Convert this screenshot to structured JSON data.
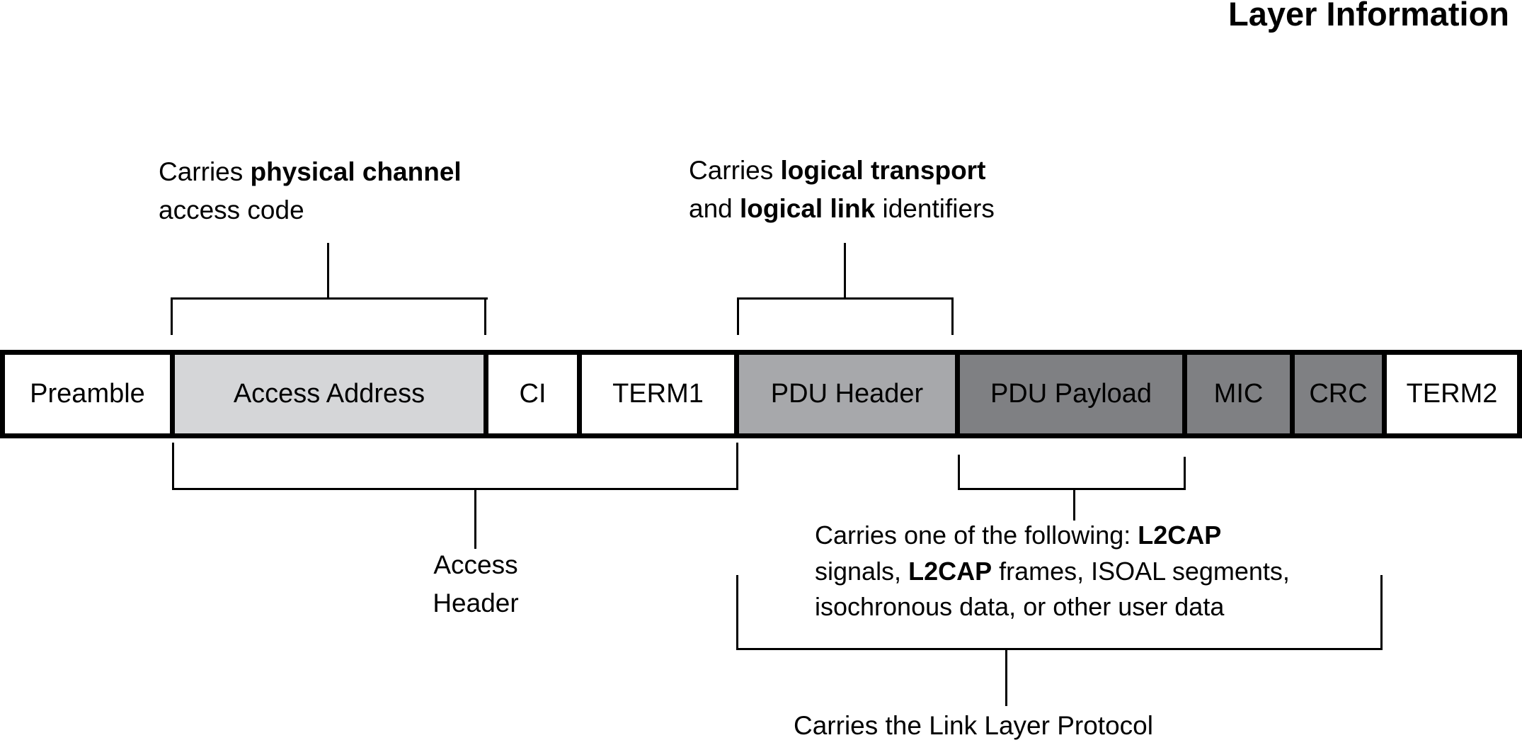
{
  "title": "Layer Information",
  "colors": {
    "white": "#ffffff",
    "light_gray": "#d5d6d8",
    "mid_gray": "#a7a8ab",
    "dark_gray": "#7f8083",
    "line": "#000000"
  },
  "fields": [
    {
      "label": "Preamble",
      "fill": "white"
    },
    {
      "label": "Access Address",
      "fill": "light_gray"
    },
    {
      "label": "CI",
      "fill": "white"
    },
    {
      "label": "TERM1",
      "fill": "white"
    },
    {
      "label": "PDU Header",
      "fill": "mid_gray"
    },
    {
      "label": "PDU Payload",
      "fill": "dark_gray"
    },
    {
      "label": "MIC",
      "fill": "dark_gray"
    },
    {
      "label": "CRC",
      "fill": "dark_gray"
    },
    {
      "label": "TERM2",
      "fill": "white"
    }
  ],
  "annotations": {
    "access_address": {
      "line1_prefix": "Carries ",
      "line1_bold": "physical channel",
      "line2": "access code"
    },
    "pdu_header": {
      "line1_prefix": "Carries ",
      "line1_bold": "logical transport",
      "line2_prefix": "and ",
      "line2_bold": "logical link",
      "line2_suffix": " identifiers"
    },
    "access_header": {
      "line1": "Access",
      "line2": "Header"
    },
    "pdu_payload": {
      "line1_prefix": "Carries one of the following: ",
      "line1_bold": "L2CAP",
      "line2_prefix": "signals, ",
      "line2_bold": "L2CAP",
      "line2_suffix": " frames, ISOAL segments,",
      "line3": "isochronous data, or other user data"
    },
    "link_layer": {
      "text": "Carries the Link Layer Protocol"
    }
  }
}
